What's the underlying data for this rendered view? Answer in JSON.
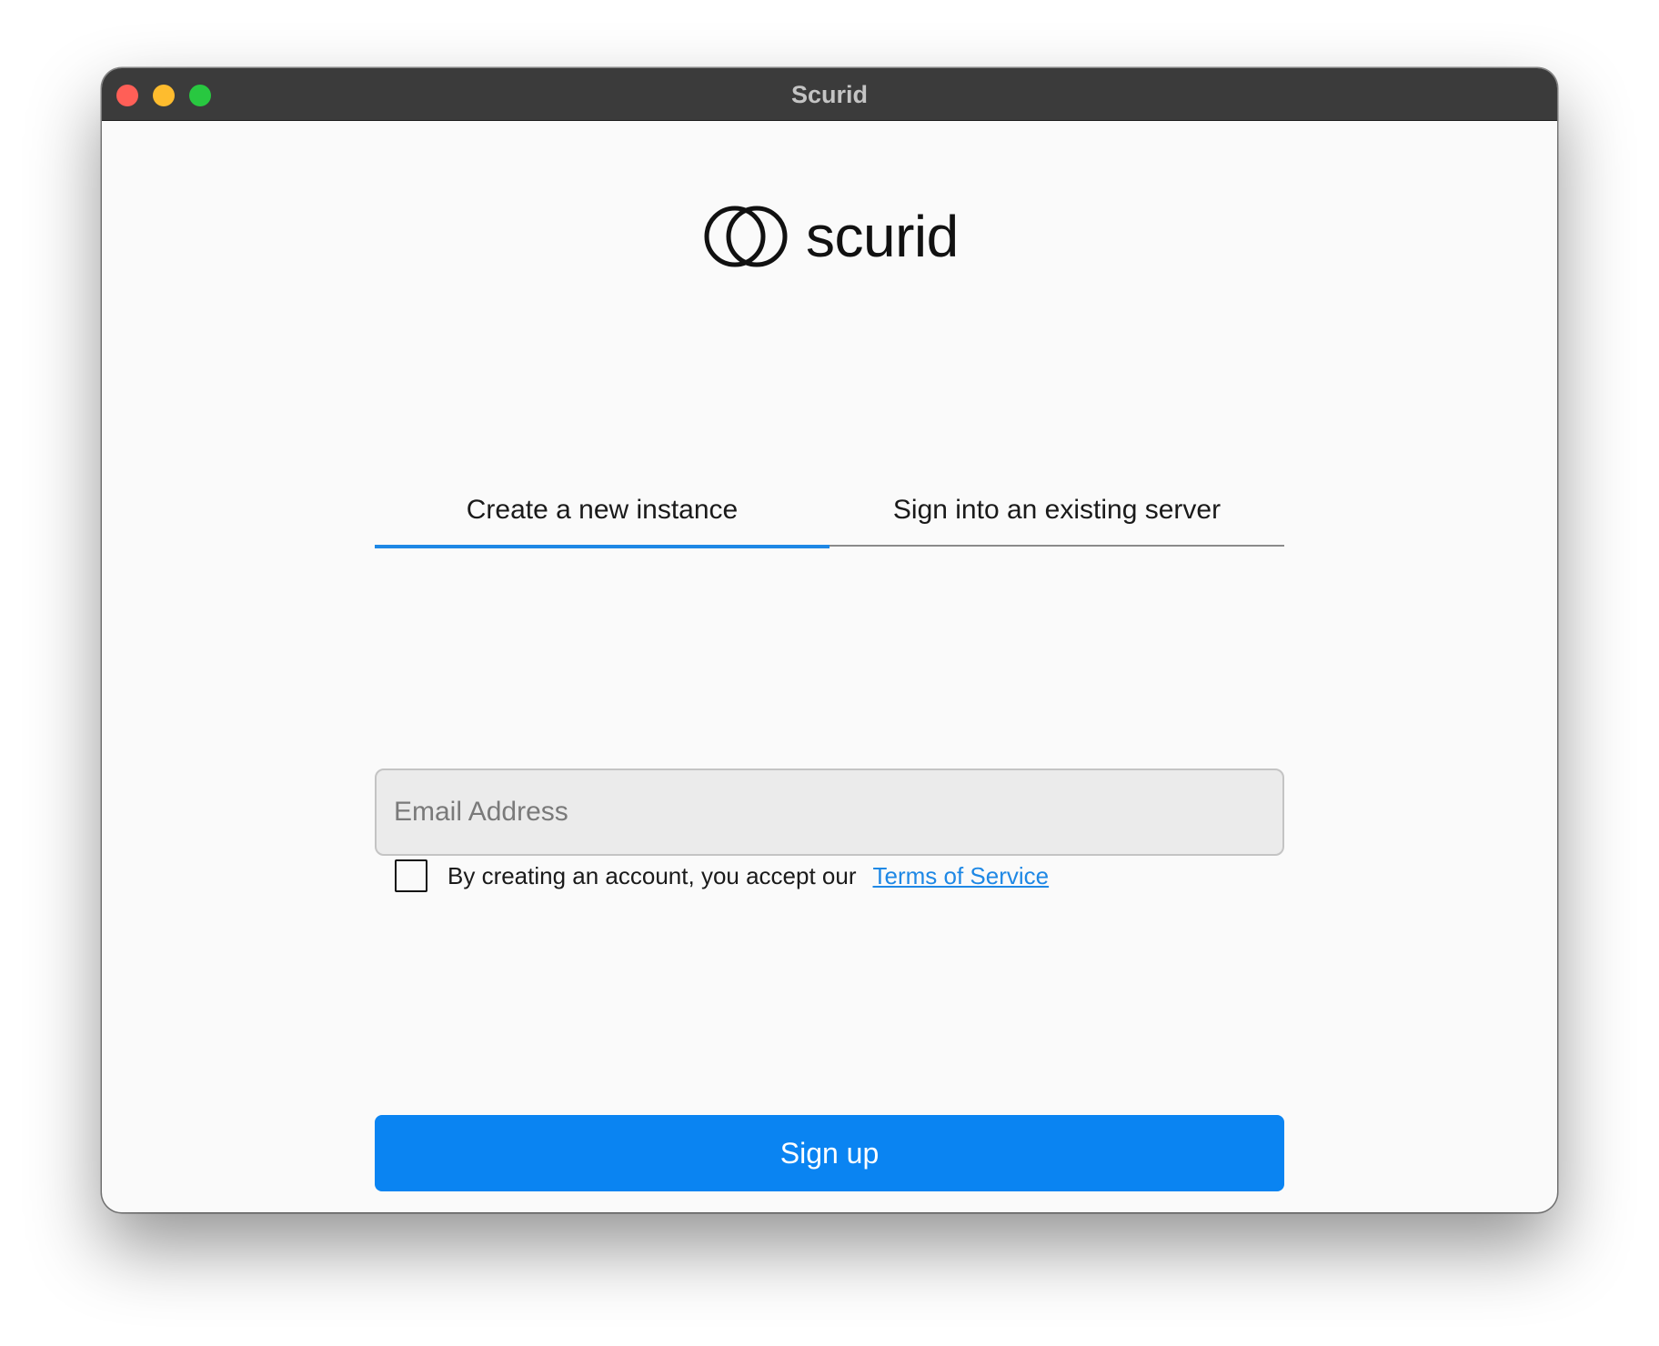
{
  "window": {
    "title": "Scurid"
  },
  "brand": {
    "name": "scurid",
    "icon": "scurid-logo-icon"
  },
  "tabs": [
    {
      "label": "Create a new instance",
      "active": true
    },
    {
      "label": "Sign into an existing server",
      "active": false
    }
  ],
  "form": {
    "email_value": "",
    "email_placeholder": "Email Address",
    "terms_checked": false,
    "terms_text": "By creating an account, you accept our",
    "terms_link": "Terms of Service",
    "submit_label": "Sign up"
  },
  "colors": {
    "accent": "#0a84f2",
    "active_tab_underline": "#1e88e5",
    "link": "#1e88e5",
    "titlebar": "#3b3b3b",
    "close": "#ff5f57",
    "minimize": "#febc2e",
    "maximize": "#28c840"
  }
}
